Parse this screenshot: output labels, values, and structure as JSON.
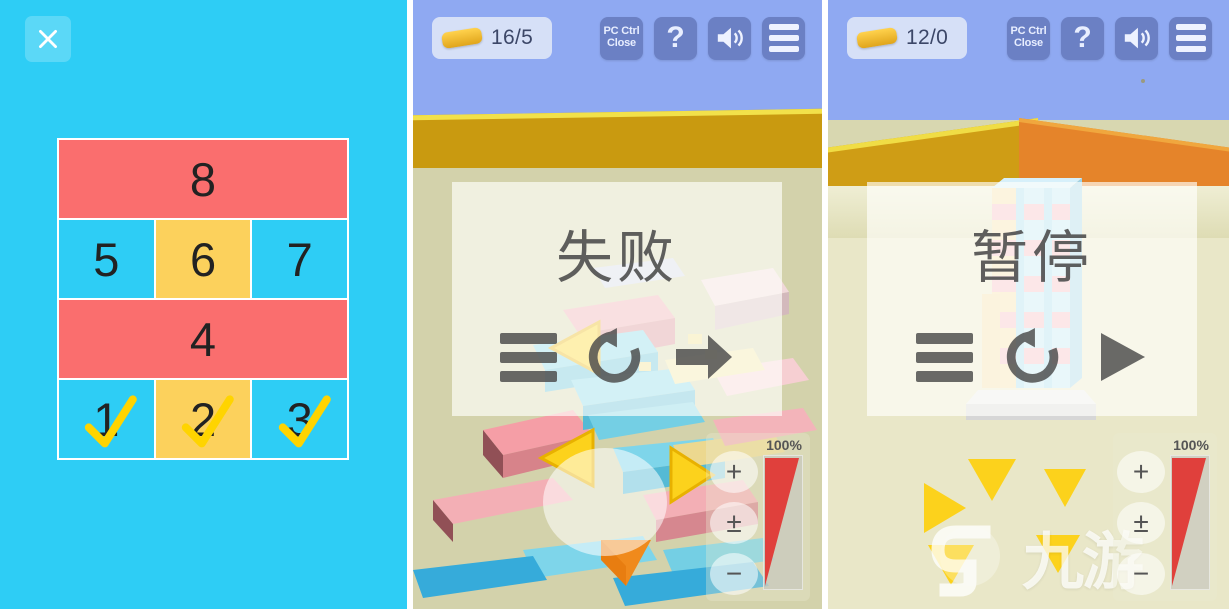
{
  "panels": [
    {
      "id": "level-select",
      "name": "Level Select",
      "background_color": "#2ecdf5",
      "close_label": "×",
      "close_icon": "close-x-icon",
      "rows": [
        {
          "type": "wide",
          "tiles": [
            {
              "label": "8",
              "color": "#fa6e6e",
              "state": "locked-wide"
            }
          ]
        },
        {
          "type": "triple",
          "tiles": [
            {
              "label": "5",
              "color": "#2ecdf5",
              "state": "available"
            },
            {
              "label": "6",
              "color": "#fcd15c",
              "state": "available"
            },
            {
              "label": "7",
              "color": "#2ecdf5",
              "state": "available"
            }
          ]
        },
        {
          "type": "wide",
          "tiles": [
            {
              "label": "4",
              "color": "#fa6e6e",
              "state": "locked-wide"
            }
          ]
        },
        {
          "type": "triple",
          "tiles": [
            {
              "label": "1",
              "color": "#2ecdf5",
              "state": "completed"
            },
            {
              "label": "2",
              "color": "#fcd15c",
              "state": "completed"
            },
            {
              "label": "3",
              "color": "#2ecdf5",
              "state": "completed"
            }
          ]
        }
      ]
    },
    {
      "id": "fail-screen",
      "name": "Fail Screen",
      "topbar": {
        "plank_icon": "plank-icon",
        "plank_count": "16/5",
        "buttons": [
          {
            "icon": "pc-ctrl-close-icon",
            "line1": "PC Ctrl",
            "line2": "Close"
          },
          {
            "icon": "help-icon",
            "label": "?"
          },
          {
            "icon": "sound-on-icon",
            "label": ""
          },
          {
            "icon": "menu-icon",
            "label": ""
          }
        ]
      },
      "dialog": {
        "title": "失败",
        "buttons": [
          {
            "icon": "menu-icon",
            "name": "menu-button"
          },
          {
            "icon": "restart-icon",
            "name": "restart-button"
          },
          {
            "icon": "next-arrow-icon",
            "name": "next-button"
          }
        ]
      },
      "side_controls": {
        "zoom_in": "+",
        "zoom_reset": "±",
        "zoom_out": "−",
        "gauge_label": "100%",
        "gauge_color": "#e0403c"
      }
    },
    {
      "id": "pause-screen",
      "name": "Pause Screen",
      "topbar": {
        "plank_icon": "plank-icon",
        "plank_count": "12/0",
        "buttons": [
          {
            "icon": "pc-ctrl-close-icon",
            "line1": "PC Ctrl",
            "line2": "Close"
          },
          {
            "icon": "help-icon",
            "label": "?"
          },
          {
            "icon": "sound-on-icon",
            "label": ""
          },
          {
            "icon": "menu-icon",
            "label": ""
          }
        ]
      },
      "dialog": {
        "title": "暂停",
        "buttons": [
          {
            "icon": "menu-icon",
            "name": "menu-button"
          },
          {
            "icon": "restart-icon",
            "name": "restart-button"
          },
          {
            "icon": "play-icon",
            "name": "resume-button"
          }
        ]
      },
      "side_controls": {
        "zoom_in": "+",
        "zoom_reset": "±",
        "zoom_out": "−",
        "gauge_label": "100%",
        "gauge_color": "#e0403c"
      },
      "watermark": {
        "text": "九游",
        "logo_icon": "jiuyou-logo-icon"
      }
    }
  ]
}
